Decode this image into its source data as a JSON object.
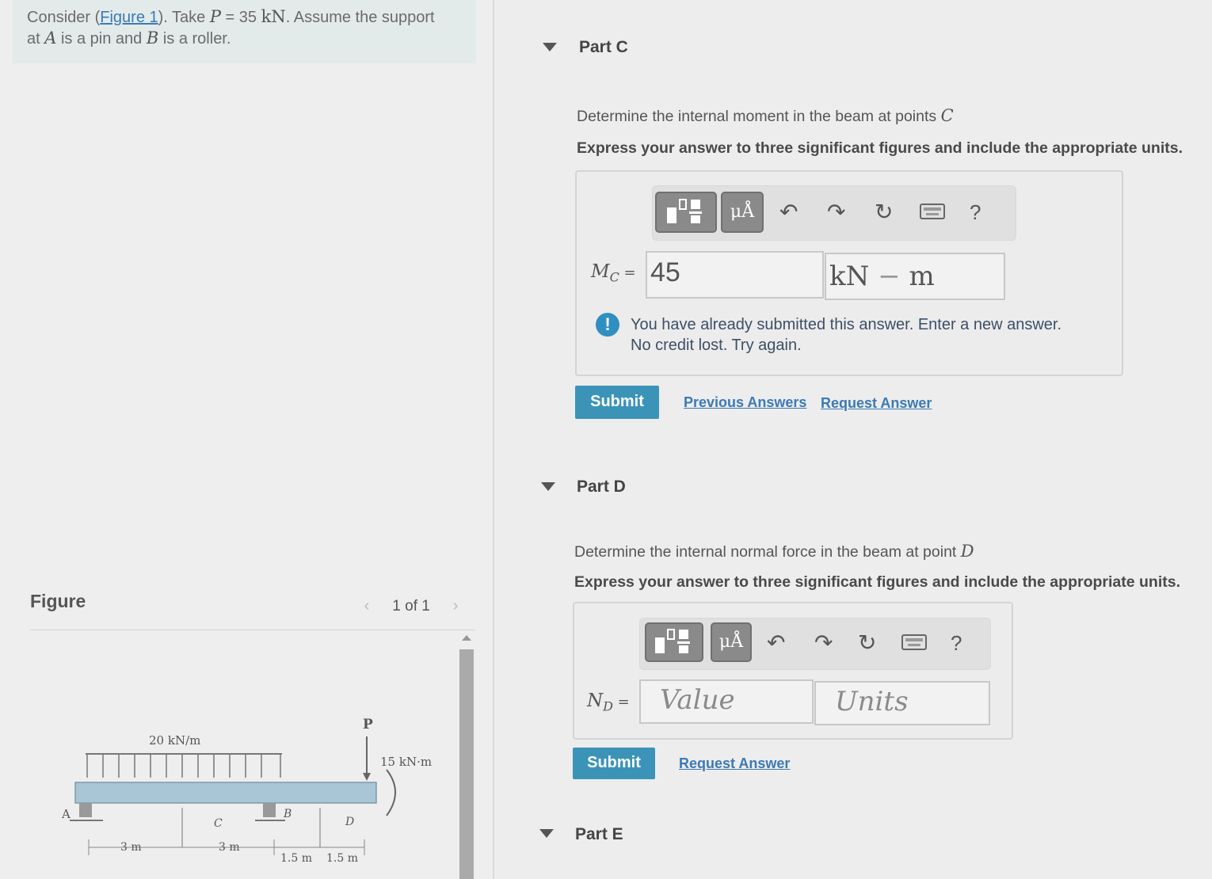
{
  "problem": {
    "consider": "Consider (",
    "figure_link": "Figure 1",
    "take": "). Take ",
    "P": "P",
    "eq": " = 35 ",
    "kN": "kN",
    "assume": ". Assume the support",
    "at": "at ",
    "A": "A",
    "pin": " is a pin and ",
    "B": "B",
    "roller": " is a roller."
  },
  "figure": {
    "title": "Figure",
    "page_indicator": "1 of 1",
    "prev_icon": "chevron-left-icon",
    "next_icon": "chevron-right-icon",
    "labels": {
      "load": "20 kN/m",
      "force": "P",
      "moment": "15 kN·m",
      "A": "A",
      "B": "B",
      "C": "C",
      "D": "D",
      "dim1": "3 m",
      "dim2": "3 m",
      "dim3": "1.5 m",
      "dim4": "1.5 m"
    }
  },
  "partC": {
    "title": "Part C",
    "prompt_text": "Determine the internal moment in the beam at points ",
    "prompt_var": "C",
    "instructions": "Express your answer to three significant figures and include the appropriate units.",
    "label_main": "M",
    "label_sub": "C",
    "label_eq": " =",
    "value": "45",
    "units_a": "kN",
    "units_dash": " − ",
    "units_b": "m",
    "warning_line1": "You have already submitted this answer. Enter a new answer.",
    "warning_line2": "No credit lost. Try again.",
    "submit": "Submit",
    "previous_answers": "Previous Answers",
    "request_answer": "Request Answer"
  },
  "partD": {
    "title": "Part D",
    "prompt_text": "Determine the internal normal force in the beam at point ",
    "prompt_var": "D",
    "instructions": "Express your answer to three significant figures and include the appropriate units.",
    "label_main": "N",
    "label_sub": "D",
    "label_eq": " =",
    "value_placeholder": "Value",
    "units_placeholder": "Units",
    "submit": "Submit",
    "request_answer": "Request Answer"
  },
  "partE": {
    "title": "Part E"
  },
  "toolbar": {
    "mu_label": "μÅ",
    "help_label": "?",
    "icons": [
      "templates-icon",
      "units-icon",
      "undo-icon",
      "redo-icon",
      "reset-icon",
      "keyboard-icon",
      "help-icon"
    ]
  }
}
